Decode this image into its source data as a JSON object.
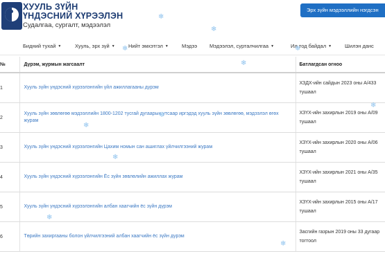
{
  "header": {
    "title_line1": "ХУУЛЬ ЗҮЙН",
    "title_line2": "ҮНДЭСНИЙ ХҮРЭЭЛЭН",
    "tagline": "Судалгаа, сургалт, мэдээлэл",
    "top_button": "Эрх зүйн мэдээллийн нэгдсэн"
  },
  "nav": {
    "items": [
      {
        "label": "Бидний тухай",
        "dropdown": true
      },
      {
        "label": "Хууль, эрх зүй",
        "dropdown": true
      },
      {
        "label": "Нийт эмхэтгэл",
        "dropdown": true
      },
      {
        "label": "Мэдээ",
        "dropdown": false
      },
      {
        "label": "Мэдээлэл, сурталчилгаа",
        "dropdown": true
      },
      {
        "label": "Ил тод байдал",
        "dropdown": true
      },
      {
        "label": "Шилэн данс",
        "dropdown": false
      }
    ]
  },
  "table": {
    "headers": {
      "num": "№",
      "name": "Дүрэм, журмын жагсаалт",
      "date": "Батлагдсан огноо"
    },
    "rows": [
      {
        "num": "1",
        "name": "Хууль зүйн үндэсний хүрээлэнгийн үйл ажиллагааны дүрэм",
        "date_line1": "ХЗДХ-ийн сайдын 2023 оны А/433",
        "date_line2": "тушаал"
      },
      {
        "num": "2",
        "name": "Хууль зүйн зөвлөгөө мэдээллийн 1800-1202 тусгай дугаарын утсаар иргэдэд хууль зүйн зөвлөгөө, мэдээлэл өгөх журам",
        "date_line1": "ХЗҮХ-ийн захирлын 2019 оны А/09",
        "date_line2": "тушаал"
      },
      {
        "num": "3",
        "name": "Хууль зүйн үндэсний хүрээлэнгийн Цахим номын сан ашиглах үйлчилгээний журам",
        "date_line1": "ХЗҮХ-ийн захирлын 2020 оны А/06",
        "date_line2": "тушаал"
      },
      {
        "num": "4",
        "name": "Хууль зүйн үндэсний хүрээлэнгийн Ёс зүйн зөвлөлийн ажиллах журам",
        "date_line1": "ХЗҮХ-ийн захирлын 2021 оны А/35",
        "date_line2": "тушаал"
      },
      {
        "num": "5",
        "name": "Хууль зүйн үндэсний хүрээлэнгийн албан хаагчийн ёс зүйн дүрэм",
        "date_line1": "ХЗҮХ-ийн захирлын 2015 оны А/17",
        "date_line2": "тушаал"
      },
      {
        "num": "6",
        "name": "Төрийн захиргааны болон үйлчилгээний албан хаагчийн ёс зүйн дүрэм",
        "date_line1": "Засгийн газрын 2019 оны 33 дугаар",
        "date_line2": "тогтоол"
      }
    ]
  },
  "colors": {
    "brand": "#1e3d73",
    "button": "#1f6fc4",
    "link": "#3a78c3",
    "snowflake": "#8fc3ee"
  },
  "icons": {
    "logo": "yin-yang-logo",
    "snowflake": "snowflake-icon",
    "caret": "caret-down-icon"
  }
}
